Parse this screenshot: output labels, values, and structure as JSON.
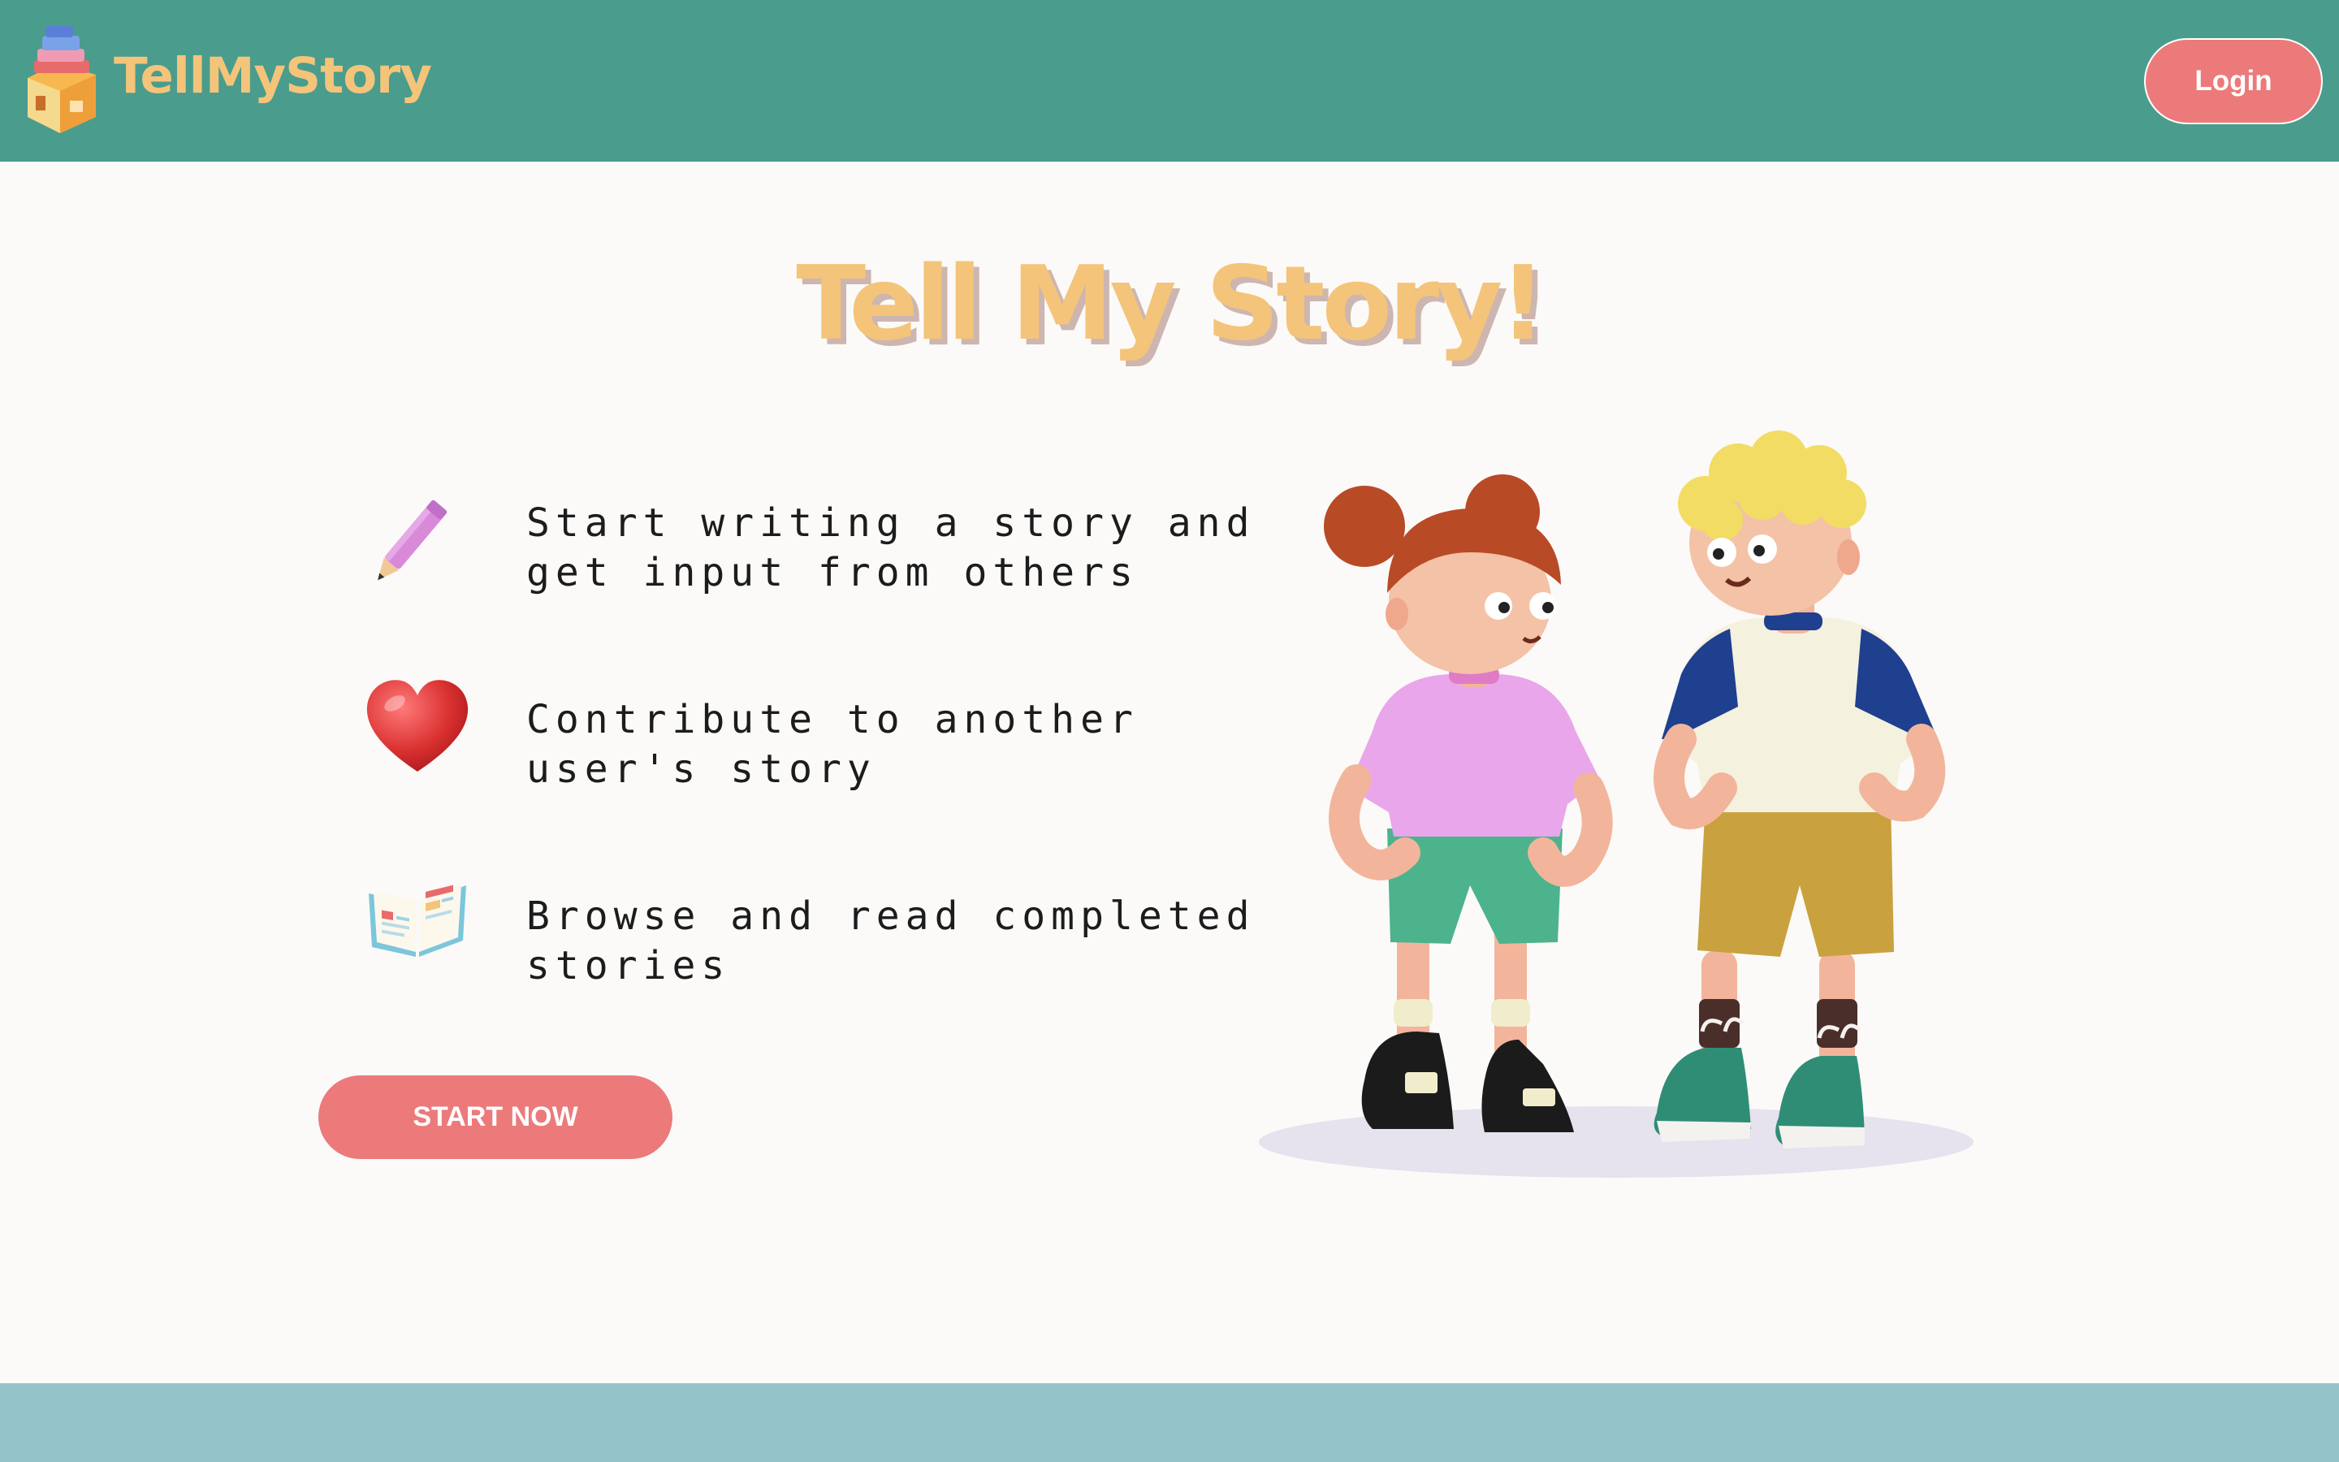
{
  "header": {
    "brand": "TellMyStory",
    "login_label": "Login",
    "logo_icon": "books-stack-icon"
  },
  "hero": {
    "title": "Tell My Story!"
  },
  "features": [
    {
      "icon": "pencil-icon",
      "line1": "Start writing a story and",
      "line2": "get input from others"
    },
    {
      "icon": "heart-icon",
      "line1": "Contribute to another",
      "line2": "user's story"
    },
    {
      "icon": "open-book-icon",
      "line1": "Browse and read completed",
      "line2": "stories"
    }
  ],
  "cta": {
    "label": "START NOW"
  },
  "colors": {
    "header_bg": "#4a9c8d",
    "brand_text": "#f4c47a",
    "button": "#ec7a7a",
    "footer_bg": "#94c4c9",
    "page_bg": "#fbfaf8"
  }
}
